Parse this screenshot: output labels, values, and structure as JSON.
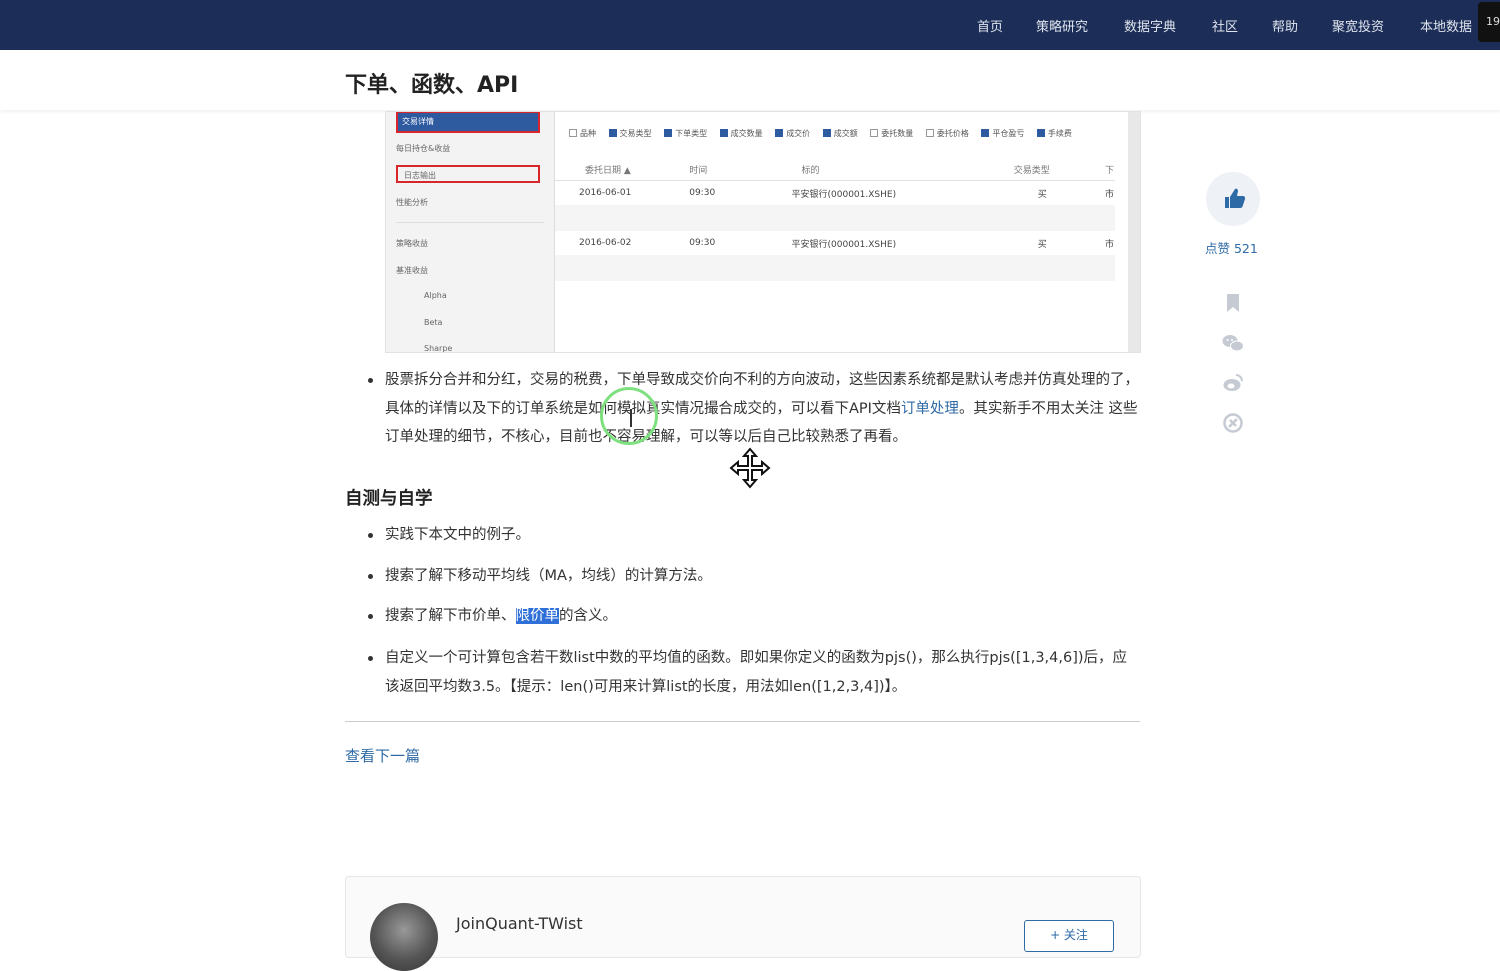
{
  "nav": {
    "items": [
      "首页",
      "策略研究",
      "数据字典",
      "社区",
      "帮助",
      "聚宽投资",
      "本地数据"
    ],
    "corner_badge": "19"
  },
  "article": {
    "title": "下单、函数、API",
    "screenshot": {
      "sidebar_items": [
        "交易详情",
        "每日持仓&收益",
        "日志输出",
        "性能分析",
        "策略收益",
        "基准收益",
        "Alpha",
        "Beta",
        "Sharpe"
      ],
      "checkboxes": [
        {
          "label": "品种",
          "checked": false
        },
        {
          "label": "交易类型",
          "checked": true
        },
        {
          "label": "下单类型",
          "checked": true
        },
        {
          "label": "成交数量",
          "checked": true
        },
        {
          "label": "成交价",
          "checked": true
        },
        {
          "label": "成交额",
          "checked": true
        },
        {
          "label": "委托数量",
          "checked": false
        },
        {
          "label": "委托价格",
          "checked": false
        },
        {
          "label": "平仓盈亏",
          "checked": true
        },
        {
          "label": "手续费",
          "checked": true
        }
      ],
      "table_headers": [
        "委托日期 ▲",
        "时间",
        "标的",
        "交易类型",
        "下"
      ],
      "rows": [
        [
          "2016-06-01",
          "09:30",
          "平安银行(000001.XSHE)",
          "买",
          "市"
        ],
        [
          "2016-06-02",
          "09:30",
          "平安银行(000001.XSHE)",
          "买",
          "市"
        ]
      ]
    },
    "para1": {
      "part1": "股票拆分合并和分红，交易的税费，下单导致成交价向不利的方向波动，这些因素系统都是默认考虑并仿真处理的了，具体的详情以及下的订单系统是如何模拟真实情况撮合成交的，可以看下API文档",
      "link": "订单处理",
      "part2": "。其实新手不用太关注 这些订单处理的细节，不核心，目前也不容易理解，可以等以后自己比较熟悉了再看。"
    },
    "section_title": "自测与自学",
    "items": {
      "item1": "实践下本文中的例子。",
      "item2": "搜索了解下移动平均线（MA，均线）的计算方法。",
      "item3_pre": "搜索了解下市价单、",
      "item3_hl": "限价单",
      "item3_post": "的含义。",
      "item4": "自定义一个可计算包含若干数list中数的平均值的函数。即如果你定义的函数为pjs()，那么执行pjs([1,3,4,6])后，应该返回平均数3.5。【提示：len()可用来计算list的长度，用法如len([1,2,3,4])】。"
    },
    "next_link": "查看下一篇"
  },
  "sidebar": {
    "like_label": "点赞 521",
    "icons": [
      "thumbs-up-icon",
      "bookmark-icon",
      "wechat-icon",
      "weibo-icon",
      "share-icon"
    ]
  },
  "author": {
    "name": "JoinQuant-TWist",
    "follow_label": "+ 关注"
  },
  "colors": {
    "nav_bg": "#1c2e57",
    "link": "#2d6aa6",
    "highlight": "#2f6fd8"
  }
}
